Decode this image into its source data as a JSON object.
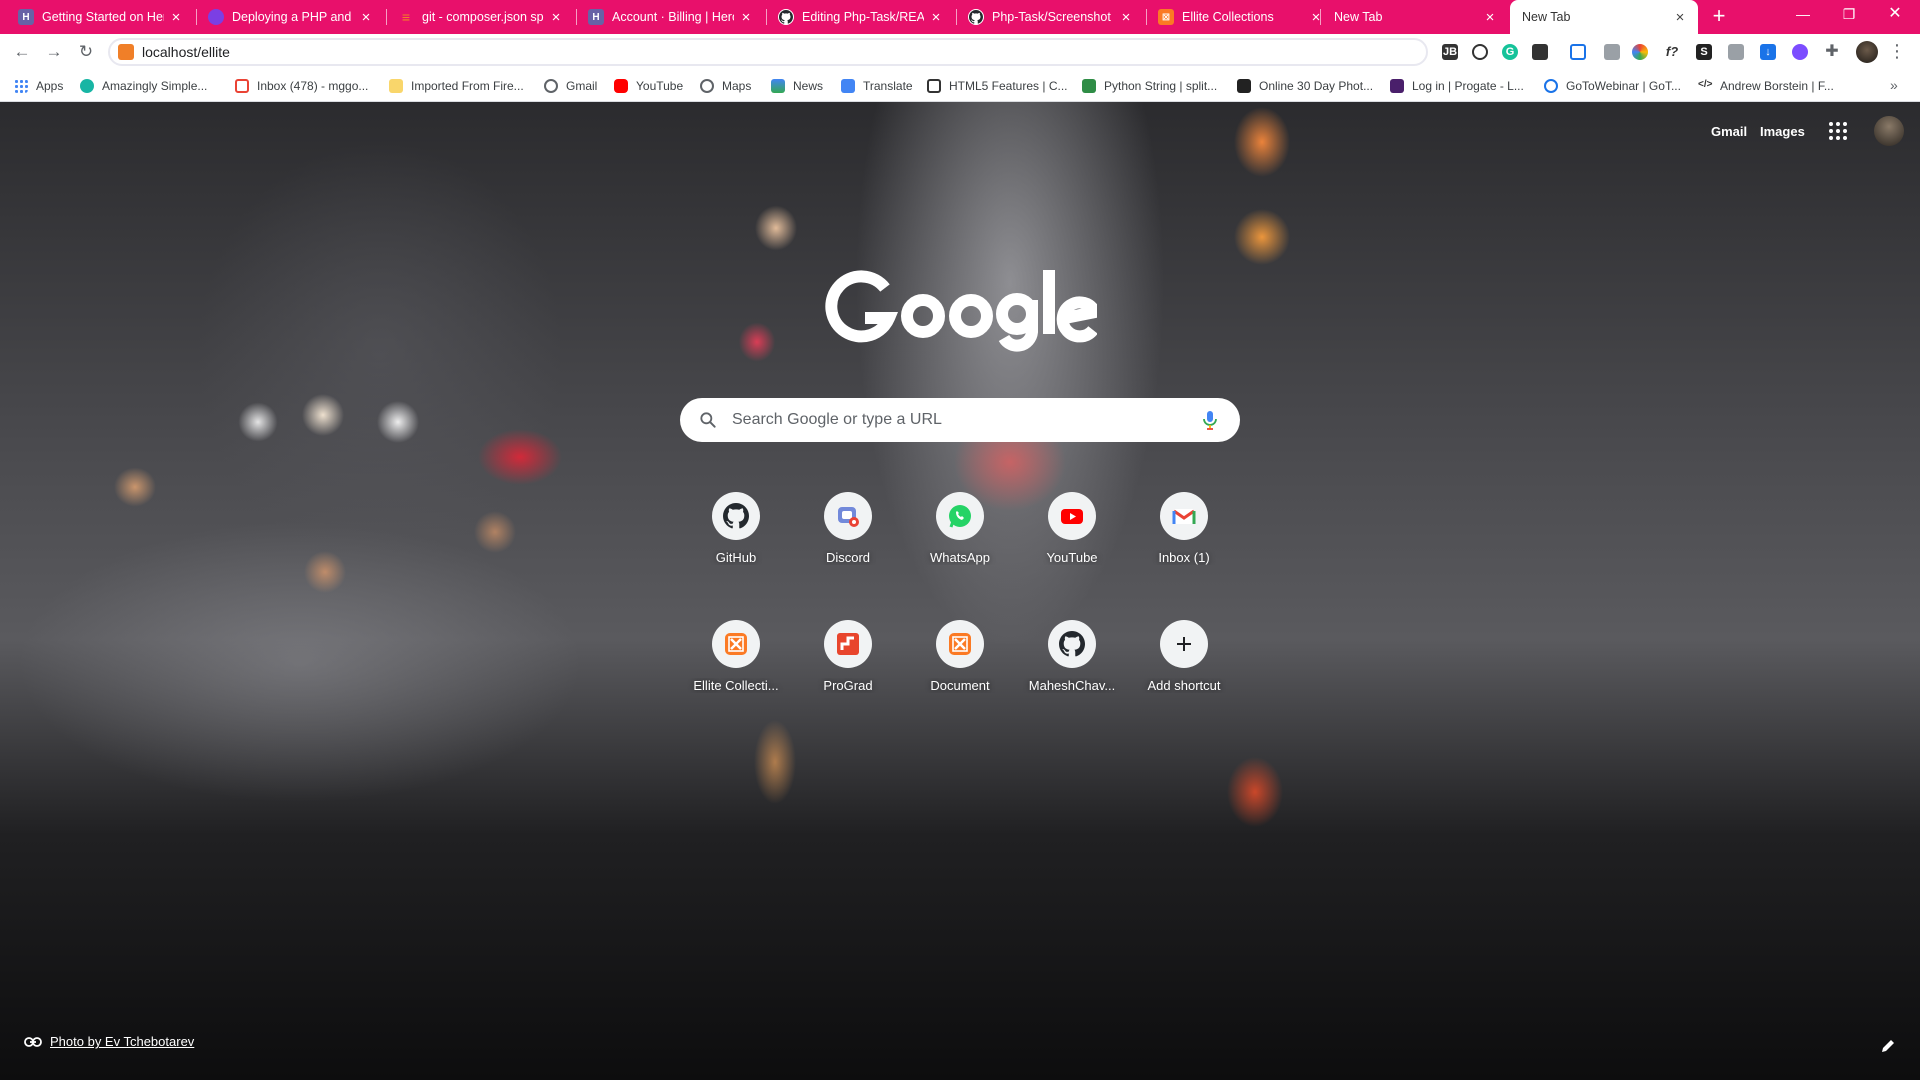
{
  "tabs": [
    {
      "title": "Getting Started on Hero",
      "favicon": "heroku-icon",
      "color": "#6762a6",
      "active": false
    },
    {
      "title": "Deploying a PHP and M",
      "favicon": "swirl-icon",
      "color": "#7b3fe4",
      "active": false
    },
    {
      "title": "git - composer.json spe",
      "favicon": "stackoverflow-icon",
      "color": "#f48024",
      "active": false
    },
    {
      "title": "Account · Billing | Herol",
      "favicon": "heroku-icon",
      "color": "#6762a6",
      "active": false
    },
    {
      "title": "Editing Php-Task/READ",
      "favicon": "github-icon",
      "color": "#24292e",
      "active": false
    },
    {
      "title": "Php-Task/Screenshot (",
      "favicon": "github-icon",
      "color": "#24292e",
      "active": false
    },
    {
      "title": "Ellite Collections",
      "favicon": "xampp-icon",
      "color": "#fb7a24",
      "active": false
    },
    {
      "title": "New Tab",
      "favicon": "",
      "color": "",
      "active": false
    },
    {
      "title": "New Tab",
      "favicon": "",
      "color": "",
      "active": true
    }
  ],
  "toolbar": {
    "url": "localhost/ellite"
  },
  "bookmarks": [
    {
      "label": "Apps",
      "icon": "apps-grid-icon",
      "color": "#4285f4"
    },
    {
      "label": "Amazingly Simple...",
      "icon": "amazingly-simple-icon",
      "color": "#18b5a4"
    },
    {
      "label": "Inbox (478) - mggo...",
      "icon": "gmail-icon",
      "color": "#ea4335"
    },
    {
      "label": "Imported From Fire...",
      "icon": "folder-icon",
      "color": "#f9d66b"
    },
    {
      "label": "Gmail",
      "icon": "globe-icon",
      "color": "#5f6368"
    },
    {
      "label": "YouTube",
      "icon": "youtube-icon",
      "color": "#ff0000"
    },
    {
      "label": "Maps",
      "icon": "globe-icon",
      "color": "#5f6368"
    },
    {
      "label": "News",
      "icon": "news-icon",
      "color": "#4285f4"
    },
    {
      "label": "Translate",
      "icon": "translate-icon",
      "color": "#4285f4"
    },
    {
      "label": "HTML5 Features | C...",
      "icon": "html5-icon",
      "color": "#333333"
    },
    {
      "label": "Python String | split...",
      "icon": "gfg-icon",
      "color": "#2f8d46"
    },
    {
      "label": "Online 30 Day Phot...",
      "icon": "photo-icon",
      "color": "#222222"
    },
    {
      "label": "Log in | Progate - L...",
      "icon": "progate-icon",
      "color": "#4a1f6b"
    },
    {
      "label": "GoToWebinar | GoT...",
      "icon": "gotowebinar-icon",
      "color": "#1a73e8"
    },
    {
      "label": "Andrew Borstein | F...",
      "icon": "code-icon",
      "color": "#333333"
    }
  ],
  "ntp": {
    "gmail_link": "Gmail",
    "images_link": "Images",
    "search_placeholder": "Search Google or type a URL",
    "shortcuts": [
      {
        "label": "GitHub",
        "icon": "github-icon",
        "color": "#24292e"
      },
      {
        "label": "Discord",
        "icon": "discord-icon",
        "color": "#7289da"
      },
      {
        "label": "WhatsApp",
        "icon": "whatsapp-icon",
        "color": "#25d366"
      },
      {
        "label": "YouTube",
        "icon": "youtube-icon",
        "color": "#ff0000"
      },
      {
        "label": "Inbox (1)",
        "icon": "gmail-icon",
        "color": "#ea4335"
      },
      {
        "label": "Ellite Collecti...",
        "icon": "xampp-icon",
        "color": "#fb7a24"
      },
      {
        "label": "ProGrad",
        "icon": "prograd-icon",
        "color": "#e8452c"
      },
      {
        "label": "Document",
        "icon": "xampp-icon",
        "color": "#fb7a24"
      },
      {
        "label": "MaheshChav...",
        "icon": "github-icon",
        "color": "#24292e"
      },
      {
        "label": "Add shortcut",
        "icon": "plus-icon",
        "color": "#202124"
      }
    ],
    "attribution": "Photo by Ev Tchebotarev"
  },
  "colors": {
    "tabstrip": "#e8106b",
    "google_logo": "#ffffff"
  }
}
